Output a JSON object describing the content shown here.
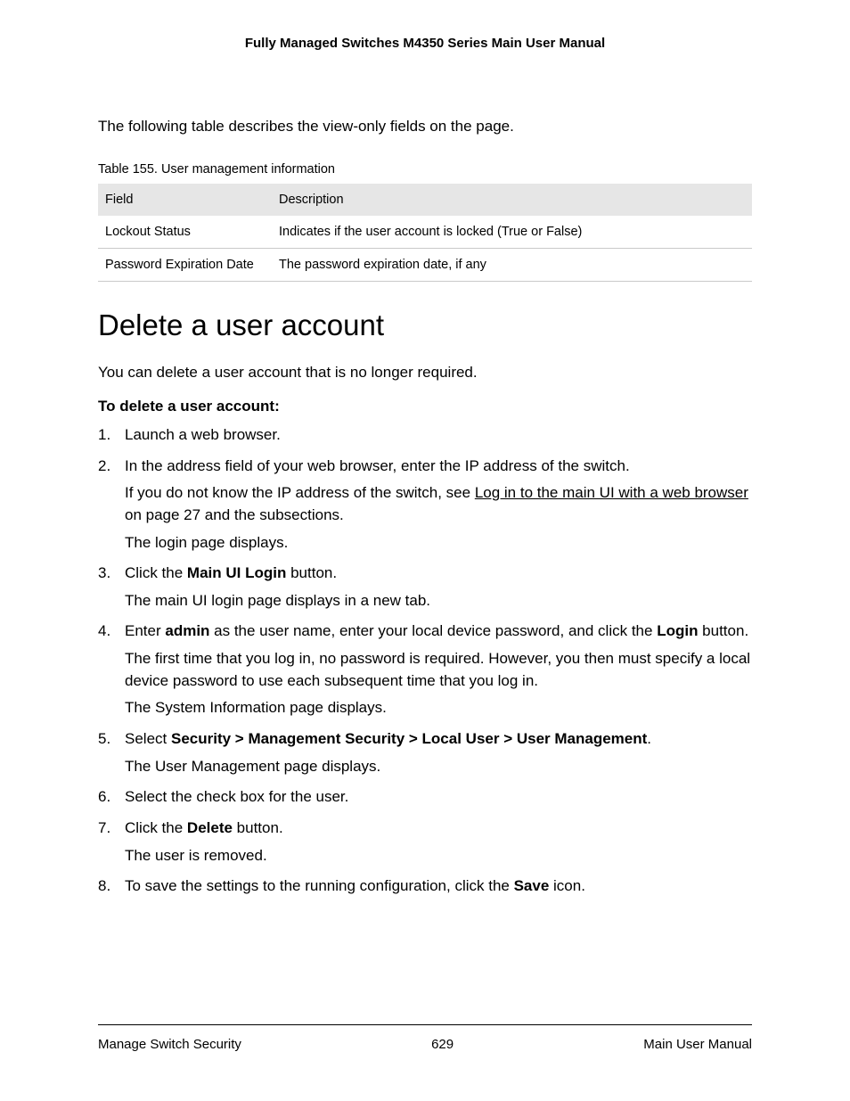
{
  "header": {
    "title": "Fully Managed Switches M4350 Series Main User Manual"
  },
  "intro": "The following table describes the view-only fields on the page.",
  "table": {
    "caption": "Table 155. User management information",
    "head": {
      "col1": "Field",
      "col2": "Description"
    },
    "rows": [
      {
        "field": "Lockout Status",
        "desc": "Indicates if the user account is locked (True or False)"
      },
      {
        "field": "Password Expiration Date",
        "desc": "The password expiration date, if any"
      }
    ]
  },
  "section_title": "Delete a user account",
  "section_intro": "You can delete a user account that is no longer required.",
  "procedure_title": "To delete a user account:",
  "steps": {
    "s1": "Launch a web browser.",
    "s2": {
      "line": "In the address field of your web browser, enter the IP address of the switch.",
      "sub1_pre": "If you do not know the IP address of the switch, see ",
      "sub1_link": "Log in to the main UI with a web browser",
      "sub1_post": " on page 27 and the subsections.",
      "sub2": "The login page displays."
    },
    "s3": {
      "pre": "Click the ",
      "bold": "Main UI Login",
      "post": " button.",
      "sub": "The main UI login page displays in a new tab."
    },
    "s4": {
      "pre": "Enter ",
      "b1": "admin",
      "mid": " as the user name, enter your local device password, and click the ",
      "b2": "Login",
      "post": " button.",
      "sub1": "The first time that you log in, no password is required. However, you then must specify a local device password to use each subsequent time that you log in.",
      "sub2": "The System Information page displays."
    },
    "s5": {
      "pre": "Select ",
      "bold": "Security > Management Security > Local User > User Management",
      "post": ".",
      "sub": "The User Management page displays."
    },
    "s6": "Select the check box for the user.",
    "s7": {
      "pre": "Click the ",
      "bold": "Delete",
      "post": " button.",
      "sub": "The user is removed."
    },
    "s8": {
      "pre": "To save the settings to the running configuration, click the ",
      "bold": "Save",
      "post": " icon."
    }
  },
  "footer": {
    "left": "Manage Switch Security",
    "center": "629",
    "right": "Main User Manual"
  }
}
